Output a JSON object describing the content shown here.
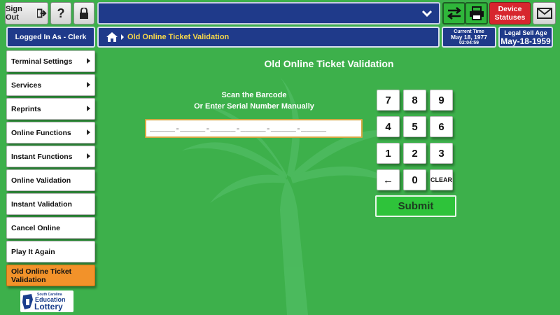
{
  "colors": {
    "background": "#3db04b",
    "navy": "#1f3a8a",
    "accent_orange": "#f2922a",
    "breadcrumb": "#f7d84a",
    "device_statuses": "#d7262e",
    "submit": "#2ec33a"
  },
  "topbar": {
    "sign_out_label": "Sign Out",
    "help_label": "?",
    "icons": [
      "exit-icon",
      "lock-icon",
      "chevron-down-icon",
      "swap-arrows-icon",
      "printer-icon",
      "envelope-icon"
    ],
    "device_statuses_line1": "Device",
    "device_statuses_line2": "Statuses"
  },
  "header": {
    "logged_in": "Logged In As - Clerk",
    "breadcrumb": "Old Online Ticket Validation",
    "current_time_label": "Current Time",
    "current_time_date": "May 18, 1977",
    "current_time_clock": "02:04:59",
    "legal_age_label": "Legal Sell Age",
    "legal_age_value": "May-18-1959"
  },
  "sidebar": {
    "items": [
      {
        "label": "Terminal Settings"
      },
      {
        "label": "Services"
      },
      {
        "label": "Reprints"
      },
      {
        "label": "Online Functions"
      },
      {
        "label": "Instant Functions"
      },
      {
        "label": "Online Validation"
      },
      {
        "label": "Instant Validation"
      },
      {
        "label": "Cancel Online"
      },
      {
        "label": "Play It Again"
      },
      {
        "label": "Old Online Ticket Validation"
      }
    ]
  },
  "main": {
    "title": "Old Online Ticket Validation",
    "scan_line1": "Scan the Barcode",
    "scan_line2": "Or Enter Serial Number Manually",
    "serial_placeholder": "_____-_____-_____-_____-_____-_____",
    "keypad": [
      "7",
      "8",
      "9",
      "4",
      "5",
      "6",
      "1",
      "2",
      "3",
      "←",
      "0",
      "CLEAR"
    ],
    "submit_label": "Submit"
  },
  "logo": {
    "line1": "South Carolina",
    "line2": "Education",
    "line3": "Lottery"
  }
}
